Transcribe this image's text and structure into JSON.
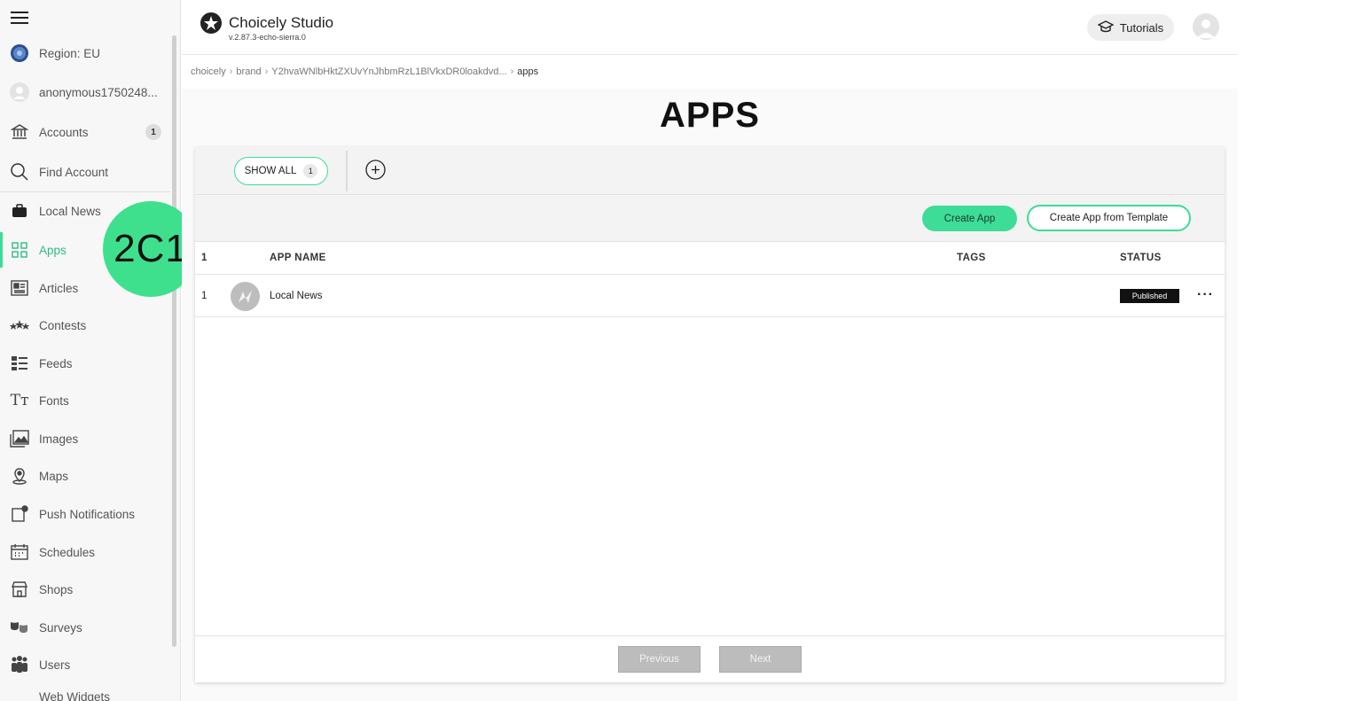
{
  "sidebar": {
    "region_label": "Region: EU",
    "user_label": "anonymous1750248...",
    "items": [
      {
        "label": "Accounts",
        "badge": "1",
        "icon": "bank-icon"
      },
      {
        "label": "Find Account",
        "icon": "search-icon"
      },
      {
        "label": "Local News",
        "icon": "briefcase-icon"
      },
      {
        "label": "Apps",
        "icon": "grid-icon",
        "active": true
      },
      {
        "label": "Articles",
        "icon": "article-icon"
      },
      {
        "label": "Contests",
        "icon": "stars-icon"
      },
      {
        "label": "Feeds",
        "icon": "feed-icon"
      },
      {
        "label": "Fonts",
        "icon": "fonts-icon"
      },
      {
        "label": "Images",
        "icon": "image-icon"
      },
      {
        "label": "Maps",
        "icon": "map-pin-icon"
      },
      {
        "label": "Push Notifications",
        "icon": "notification-icon"
      },
      {
        "label": "Schedules",
        "icon": "calendar-icon"
      },
      {
        "label": "Shops",
        "icon": "shop-icon"
      },
      {
        "label": "Surveys",
        "icon": "masks-icon"
      },
      {
        "label": "Users",
        "icon": "users-icon"
      },
      {
        "label": "Web Widgets",
        "icon": "widget-icon"
      }
    ]
  },
  "overlay_label": "2C1",
  "header": {
    "title": "Choicely Studio",
    "version": "v.2.87.3-echo-sierra.0",
    "tutorials_label": "Tutorials"
  },
  "breadcrumb": [
    "choicely",
    "brand",
    "Y2hvaWNlbHktZXUvYnJhbmRzL1BlVkxDR0loakdvd...",
    "apps"
  ],
  "page_title": "APPS",
  "filters": {
    "show_all_label": "SHOW ALL",
    "show_all_count": "1"
  },
  "actions": {
    "create_app": "Create App",
    "create_from_template": "Create App from Template"
  },
  "table": {
    "count": "1",
    "columns": {
      "name": "APP NAME",
      "tags": "TAGS",
      "status": "STATUS"
    },
    "rows": [
      {
        "index": "1",
        "name": "Local News",
        "tags": "",
        "status": "Published"
      }
    ]
  },
  "pagination": {
    "previous": "Previous",
    "next": "Next"
  },
  "colors": {
    "accent": "#3ddc97",
    "status_published": "#111111"
  }
}
